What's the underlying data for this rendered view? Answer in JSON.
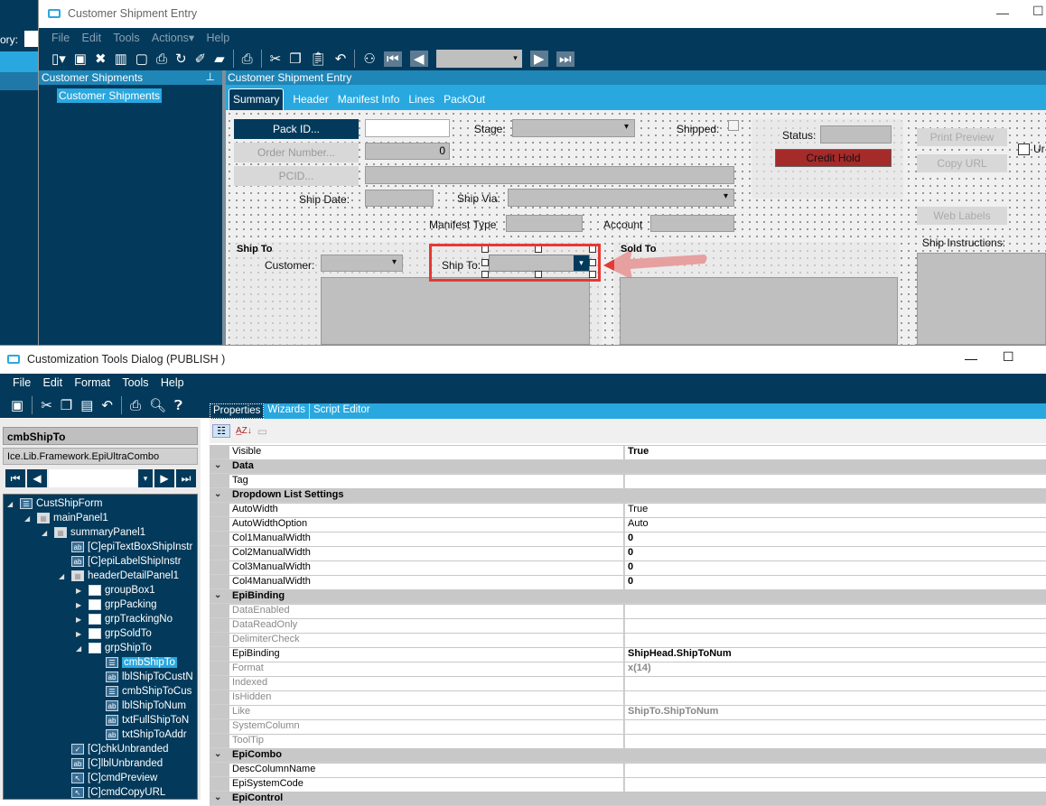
{
  "background": {
    "label": "ory:"
  },
  "main_window": {
    "title": "Customer Shipment Entry",
    "menu": [
      "File",
      "Edit",
      "Tools",
      "Actions▾",
      "Help"
    ],
    "nav_pane": {
      "title": "Customer Shipments",
      "item": "Customer Shipments"
    },
    "content_title": "Customer Shipment Entry",
    "tabs": [
      "Summary",
      "Header",
      "Manifest Info",
      "Lines",
      "PackOut"
    ],
    "active_tab": "Summary",
    "form": {
      "pack_id_button": "Pack ID...",
      "pack_id_value": "",
      "order_number_button": "Order Number...",
      "order_number_value": "0",
      "pcid_button": "PCID...",
      "stage_label": "Stage:",
      "shipped_label": "Shipped:",
      "ship_date_label": "Ship Date:",
      "ship_via_label": "Ship Via:",
      "manifest_type_label": "Manifest Type",
      "account_label": "Account",
      "status_label": "Status:",
      "credit_hold": "Credit Hold",
      "print_preview": "Print Preview",
      "copy_url": "Copy URL",
      "web_labels": "Web Labels",
      "unbranded_label": "Ur",
      "ship_instructions_label": "Ship Instructions:",
      "ship_to_group": "Ship To",
      "customer_label": "Customer:",
      "ship_to_label": "Ship To:",
      "sold_to_group": "Sold To"
    }
  },
  "colors": {
    "navy": "#033a5b",
    "accent": "#29a8e0",
    "credit_hold": "#a52a2a",
    "highlight": "#e53935"
  },
  "tools_dialog": {
    "title": "Customization Tools Dialog  (PUBLISH )",
    "menu": [
      "File",
      "Edit",
      "Format",
      "Tools",
      "Help"
    ],
    "selected_control": "cmbShipTo",
    "control_type": "Ice.Lib.Framework.EpiUltraCombo",
    "tabs": [
      "Properties",
      "Wizards",
      "Script Editor"
    ],
    "tree": [
      {
        "label": "CustShipForm",
        "level": 0,
        "icon": "form-icon",
        "exp": "open"
      },
      {
        "label": "mainPanel1",
        "level": 1,
        "icon": "panel-icon",
        "exp": "open"
      },
      {
        "label": "summaryPanel1",
        "level": 2,
        "icon": "panel-icon",
        "exp": "open"
      },
      {
        "label": "[C]epiTextBoxShipInstr",
        "level": 3,
        "icon": "textbox-icon",
        "exp": ""
      },
      {
        "label": "[C]epiLabelShipInstr",
        "level": 3,
        "icon": "label-icon",
        "exp": ""
      },
      {
        "label": "headerDetailPanel1",
        "level": 3,
        "icon": "panel-icon",
        "exp": "open"
      },
      {
        "label": "groupBox1",
        "level": 4,
        "icon": "folder-icon",
        "exp": "closed"
      },
      {
        "label": "grpPacking",
        "level": 4,
        "icon": "folder-icon",
        "exp": "closed"
      },
      {
        "label": "grpTrackingNo",
        "level": 4,
        "icon": "folder-icon",
        "exp": "closed"
      },
      {
        "label": "grpSoldTo",
        "level": 4,
        "icon": "folder-icon",
        "exp": "closed"
      },
      {
        "label": "grpShipTo",
        "level": 4,
        "icon": "folder-icon",
        "exp": "open"
      },
      {
        "label": "cmbShipTo",
        "level": 5,
        "icon": "combo-icon",
        "exp": "",
        "selected": true
      },
      {
        "label": "lblShipToCustN",
        "level": 5,
        "icon": "label-icon",
        "exp": ""
      },
      {
        "label": "cmbShipToCus",
        "level": 5,
        "icon": "combo-icon",
        "exp": ""
      },
      {
        "label": "lblShipToNum",
        "level": 5,
        "icon": "label-icon",
        "exp": ""
      },
      {
        "label": "txtFullShipToN",
        "level": 5,
        "icon": "textbox-icon",
        "exp": ""
      },
      {
        "label": "txtShipToAddr",
        "level": 5,
        "icon": "textbox-icon",
        "exp": ""
      },
      {
        "label": "[C]chkUnbranded",
        "level": 3,
        "icon": "checkbox-icon",
        "exp": ""
      },
      {
        "label": "[C]lblUnbranded",
        "level": 3,
        "icon": "label-icon",
        "exp": ""
      },
      {
        "label": "[C]cmdPreview",
        "level": 3,
        "icon": "button-icon",
        "exp": ""
      },
      {
        "label": "[C]cmdCopyURL",
        "level": 3,
        "icon": "button-icon",
        "exp": ""
      }
    ],
    "properties": [
      {
        "name": "Visible",
        "value": "True",
        "bold": true
      },
      {
        "category": "Data"
      },
      {
        "name": "Tag",
        "value": ""
      },
      {
        "category": "Dropdown List Settings"
      },
      {
        "name": "AutoWidth",
        "value": "True"
      },
      {
        "name": "AutoWidthOption",
        "value": "Auto"
      },
      {
        "name": "Col1ManualWidth",
        "value": "0",
        "bold": true
      },
      {
        "name": "Col2ManualWidth",
        "value": "0",
        "bold": true
      },
      {
        "name": "Col3ManualWidth",
        "value": "0",
        "bold": true
      },
      {
        "name": "Col4ManualWidth",
        "value": "0",
        "bold": true
      },
      {
        "category": "EpiBinding"
      },
      {
        "name": "DataEnabled",
        "value": "",
        "gray": true
      },
      {
        "name": "DataReadOnly",
        "value": "",
        "gray": true
      },
      {
        "name": "DelimiterCheck",
        "value": "",
        "gray": true
      },
      {
        "name": "EpiBinding",
        "value": "ShipHead.ShipToNum",
        "bold": true
      },
      {
        "name": "Format",
        "value": "x(14)",
        "gray": true,
        "bold": true
      },
      {
        "name": "Indexed",
        "value": "",
        "gray": true
      },
      {
        "name": "IsHidden",
        "value": "",
        "gray": true
      },
      {
        "name": "Like",
        "value": "ShipTo.ShipToNum",
        "gray": true,
        "bold": true
      },
      {
        "name": "SystemColumn",
        "value": "",
        "gray": true
      },
      {
        "name": "ToolTip",
        "value": "",
        "gray": true
      },
      {
        "category": "EpiCombo"
      },
      {
        "name": "DescColumnName",
        "value": ""
      },
      {
        "name": "EpiSystemCode",
        "value": ""
      },
      {
        "category": "EpiControl"
      }
    ]
  }
}
